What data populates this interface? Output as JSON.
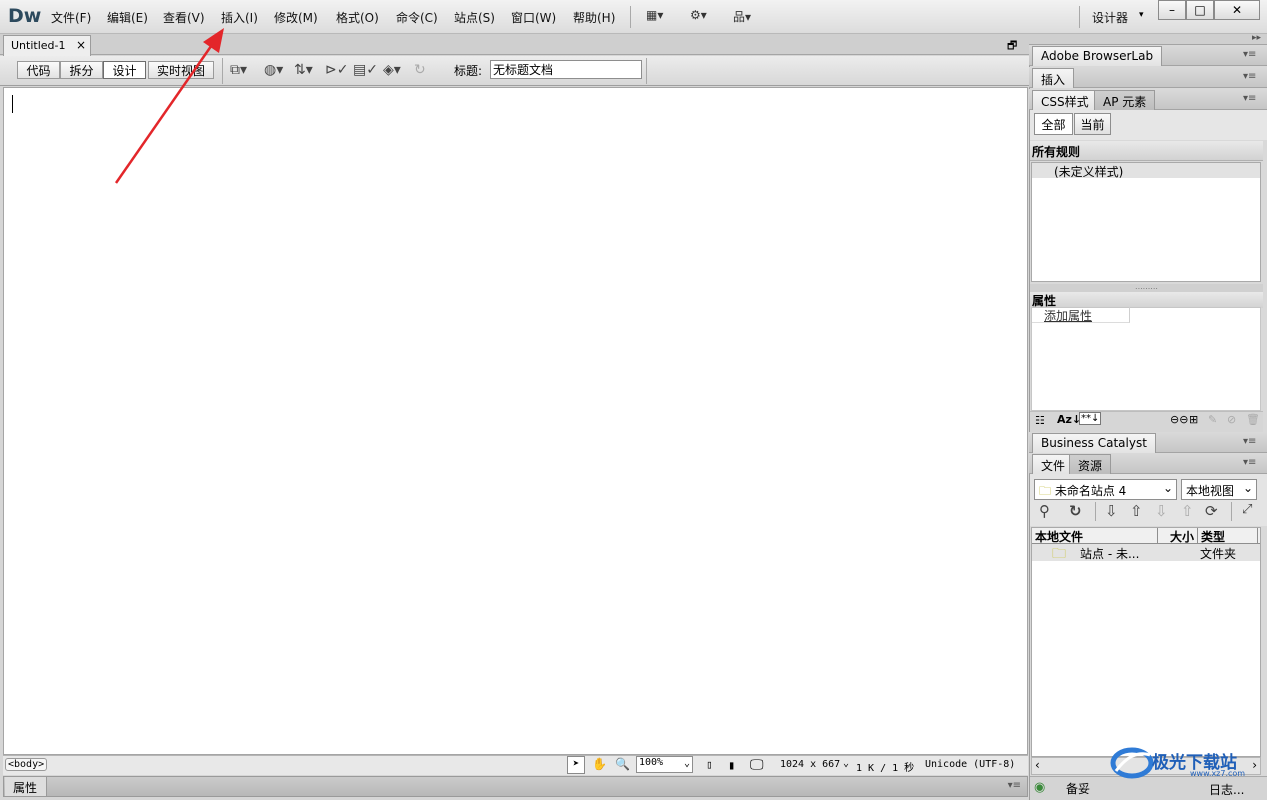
{
  "app": {
    "logo": "Dw",
    "menu": [
      "文件(F)",
      "编辑(E)",
      "查看(V)",
      "插入(I)",
      "修改(M)",
      "格式(O)",
      "命令(C)",
      "站点(S)",
      "窗口(W)",
      "帮助(H)"
    ],
    "workspace": "设计器",
    "window_buttons": [
      "–",
      "□",
      "✕"
    ]
  },
  "document": {
    "tab_title": "Untitled-1",
    "tab_close": "×",
    "view_buttons": [
      "代码",
      "拆分",
      "设计",
      "实时视图"
    ],
    "active_view": "设计",
    "title_label": "标题:",
    "title_value": "无标题文档"
  },
  "statusbar": {
    "tag": "<body>",
    "zoom": "100%",
    "size": "1024 x 667",
    "filesize": "1 K / 1 秒",
    "encoding": "Unicode (UTF-8)"
  },
  "properties_bar": {
    "label": "属性"
  },
  "panels": {
    "browserlab": "Adobe BrowserLab",
    "insert": "插入",
    "css_tab": "CSS样式",
    "ap_tab": "AP 元素",
    "css_all": "全部",
    "css_current": "当前",
    "all_rules": "所有规则",
    "undefined_style": "(未定义样式)",
    "properties": "属性",
    "add_property": "添加属性",
    "business_catalyst": "Business Catalyst",
    "files_tab": "文件",
    "assets_tab": "资源",
    "site_select": "未命名站点 4",
    "view_select": "本地视图",
    "col_local": "本地文件",
    "col_size": "大小",
    "col_type": "类型",
    "site_row_name": "站点 - 未...",
    "site_row_type": "文件夹",
    "backup_label": "备妥",
    "log_label": "日志..."
  },
  "watermark": {
    "text": "极光下载站",
    "sub": "www.xz7.com"
  },
  "colors": {
    "arrow": "#e3262a",
    "logo": "#2d4a5e",
    "folder": "#c9c22a"
  }
}
